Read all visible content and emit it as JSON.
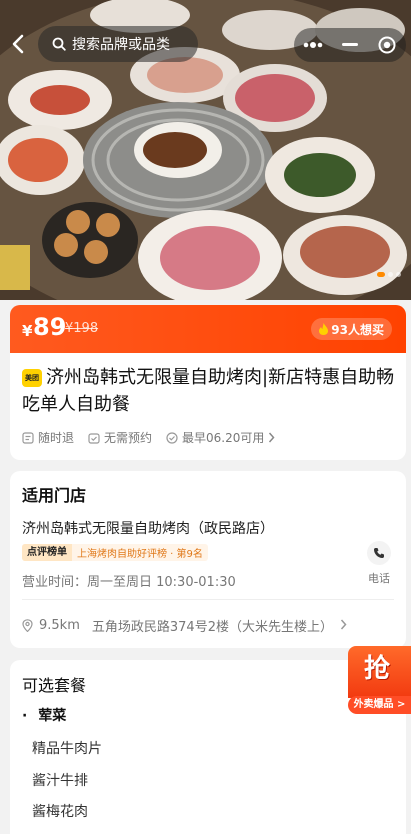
{
  "search": {
    "placeholder": "搜索品牌或品类"
  },
  "price": {
    "currency": "¥",
    "current": "89",
    "original": "¥198"
  },
  "want": {
    "label": "93人想买"
  },
  "deal": {
    "brand_logo": "美团",
    "title": "济州岛韩式无限量自助烤肉|新店特惠自助畅吃单人自助餐",
    "tags": [
      "随时退",
      "无需预约",
      "最早06.20可用"
    ]
  },
  "store": {
    "section_title": "适用门店",
    "name": "济州岛韩式无限量自助烤肉（政民路店）",
    "rank_tag": "点评榜单",
    "rank_text": "上海烤肉自助好评榜 · 第9名",
    "hours": "营业时间：周一至周日 10:30-01:30",
    "phone_label": "电话",
    "distance": "9.5km",
    "address": "五角场政民路374号2楼（大米先生楼上）"
  },
  "packages": {
    "title": "可选套餐",
    "category": "荤菜",
    "items": [
      "精品牛肉片",
      "酱汁牛排",
      "酱梅花肉"
    ]
  },
  "promo": {
    "char": "抢",
    "label": "外卖爆品 >"
  },
  "colors": {
    "accent": "#ff4d1a",
    "rank": "#e0791a"
  },
  "icons": [
    "back-arrow-icon",
    "search-icon",
    "more-dots-icon",
    "minimize-icon",
    "close-circle-icon",
    "fire-icon",
    "refund-icon",
    "calendar-check-icon",
    "check-circle-icon",
    "phone-icon",
    "location-icon",
    "chevron-right-icon"
  ]
}
